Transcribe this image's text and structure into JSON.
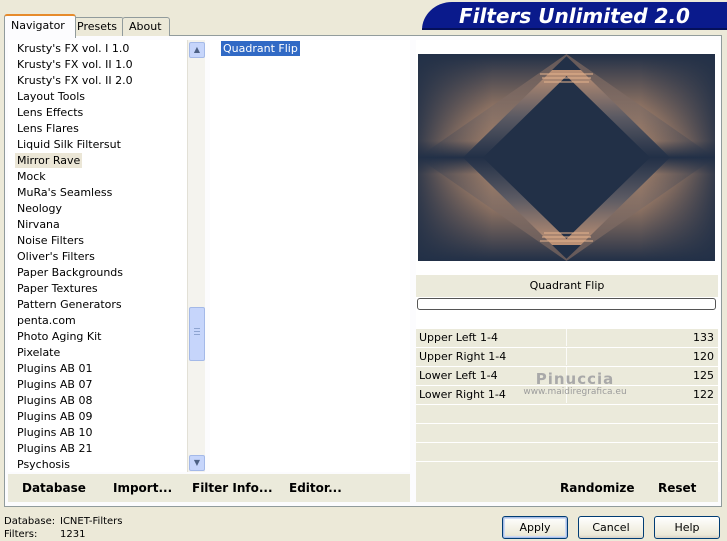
{
  "app_title": "Filters Unlimited 2.0",
  "tabs": [
    {
      "label": "Navigator"
    },
    {
      "label": "Presets"
    },
    {
      "label": "About"
    }
  ],
  "categories": [
    "Krusty's FX vol. I 1.0",
    "Krusty's FX vol. II 1.0",
    "Krusty's FX vol. II 2.0",
    "Layout Tools",
    "Lens Effects",
    "Lens Flares",
    "Liquid Silk Filtersut",
    "Mirror Rave",
    "Mock",
    "MuRa's Seamless",
    "Neology",
    "Nirvana",
    "Noise Filters",
    "Oliver's Filters",
    "Paper Backgrounds",
    "Paper Textures",
    "Pattern Generators",
    "penta.com",
    "Photo Aging Kit",
    "Pixelate",
    "Plugins AB 01",
    "Plugins AB 07",
    "Plugins AB 08",
    "Plugins AB 09",
    "Plugins AB 10",
    "Plugins AB 21",
    "Psychosis"
  ],
  "selected_category": "Mirror Rave",
  "filters": [
    "Quadrant Flip"
  ],
  "current_filter": "Quadrant Flip",
  "progress": 0,
  "parameters": [
    {
      "label": "Upper Left 1-4",
      "value": "133"
    },
    {
      "label": "Upper Right 1-4",
      "value": "120"
    },
    {
      "label": "Lower Left 1-4",
      "value": "125"
    },
    {
      "label": "Lower Right 1-4",
      "value": "122"
    }
  ],
  "watermark": {
    "title": "Pinuccia",
    "url": "www.maidiregrafica.eu"
  },
  "bottom_left_buttons": {
    "database": "Database",
    "import": "Import...",
    "filter_info": "Filter Info...",
    "editor": "Editor..."
  },
  "bottom_right_buttons": {
    "randomize": "Randomize",
    "reset": "Reset"
  },
  "status": {
    "database_label": "Database:",
    "database_value": "ICNET-Filters",
    "filters_label": "Filters:",
    "filters_value": "1231"
  },
  "dialog_buttons": {
    "apply": "Apply",
    "cancel": "Cancel",
    "help": "Help"
  },
  "colors": {
    "banner": "#0a1a8c",
    "selection": "#316ac5",
    "preview_dark": "#223047",
    "preview_light": "#d39d74"
  }
}
